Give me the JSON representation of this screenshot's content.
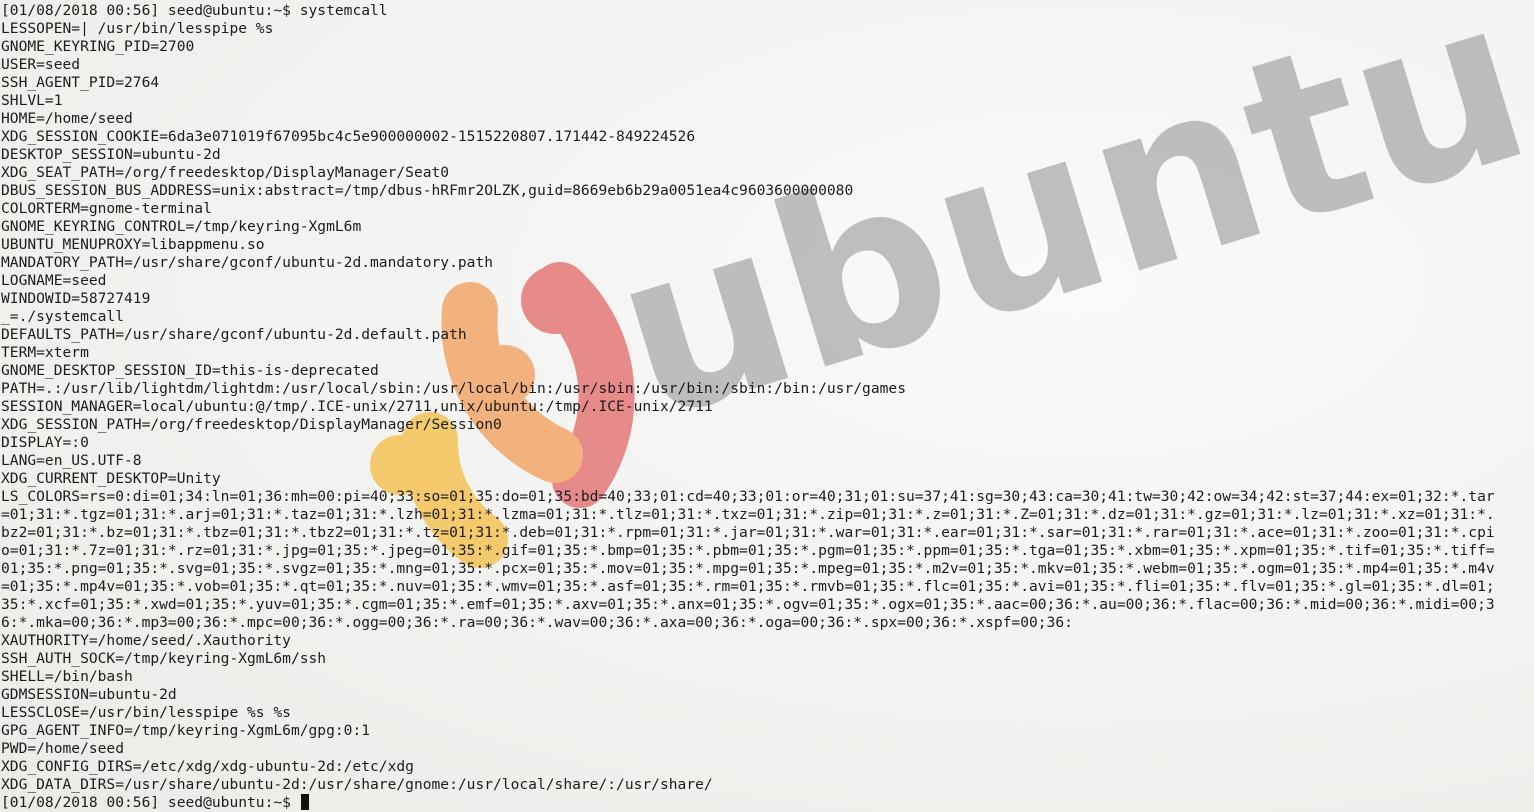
{
  "wallpaper": {
    "logo_text": "ubuntu",
    "logo_colors": {
      "red": "#dd4a4a",
      "orange": "#f08a38",
      "yellow": "#f5b21e"
    },
    "text_color": "#8f8f8f"
  },
  "terminal": {
    "lines": [
      "[01/08/2018 00:56] seed@ubuntu:~$ systemcall",
      "LESSOPEN=| /usr/bin/lesspipe %s",
      "GNOME_KEYRING_PID=2700",
      "USER=seed",
      "SSH_AGENT_PID=2764",
      "SHLVL=1",
      "HOME=/home/seed",
      "XDG_SESSION_COOKIE=6da3e071019f67095bc4c5e900000002-1515220807.171442-849224526",
      "DESKTOP_SESSION=ubuntu-2d",
      "XDG_SEAT_PATH=/org/freedesktop/DisplayManager/Seat0",
      "DBUS_SESSION_BUS_ADDRESS=unix:abstract=/tmp/dbus-hRFmr2OLZK,guid=8669eb6b29a0051ea4c9603600000080",
      "COLORTERM=gnome-terminal",
      "GNOME_KEYRING_CONTROL=/tmp/keyring-XgmL6m",
      "UBUNTU_MENUPROXY=libappmenu.so",
      "MANDATORY_PATH=/usr/share/gconf/ubuntu-2d.mandatory.path",
      "LOGNAME=seed",
      "WINDOWID=58727419",
      "_=./systemcall",
      "DEFAULTS_PATH=/usr/share/gconf/ubuntu-2d.default.path",
      "TERM=xterm",
      "GNOME_DESKTOP_SESSION_ID=this-is-deprecated",
      "PATH=.:/usr/lib/lightdm/lightdm:/usr/local/sbin:/usr/local/bin:/usr/sbin:/usr/bin:/sbin:/bin:/usr/games",
      "SESSION_MANAGER=local/ubuntu:@/tmp/.ICE-unix/2711,unix/ubuntu:/tmp/.ICE-unix/2711",
      "XDG_SESSION_PATH=/org/freedesktop/DisplayManager/Session0",
      "DISPLAY=:0",
      "LANG=en_US.UTF-8",
      "XDG_CURRENT_DESKTOP=Unity",
      "LS_COLORS=rs=0:di=01;34:ln=01;36:mh=00:pi=40;33:so=01;35:do=01;35:bd=40;33;01:cd=40;33;01:or=40;31;01:su=37;41:sg=30;43:ca=30;41:tw=30;42:ow=34;42:st=37;44:ex=01;32:*.tar",
      "=01;31:*.tgz=01;31:*.arj=01;31:*.taz=01;31:*.lzh=01;31:*.lzma=01;31:*.tlz=01;31:*.txz=01;31:*.zip=01;31:*.z=01;31:*.Z=01;31:*.dz=01;31:*.gz=01;31:*.lz=01;31:*.xz=01;31:*.",
      "bz2=01;31:*.bz=01;31:*.tbz=01;31:*.tbz2=01;31:*.tz=01;31:*.deb=01;31:*.rpm=01;31:*.jar=01;31:*.war=01;31:*.ear=01;31:*.sar=01;31:*.rar=01;31:*.ace=01;31:*.zoo=01;31:*.cpi",
      "o=01;31:*.7z=01;31:*.rz=01;31:*.jpg=01;35:*.jpeg=01;35:*.gif=01;35:*.bmp=01;35:*.pbm=01;35:*.pgm=01;35:*.ppm=01;35:*.tga=01;35:*.xbm=01;35:*.xpm=01;35:*.tif=01;35:*.tiff=",
      "01;35:*.png=01;35:*.svg=01;35:*.svgz=01;35:*.mng=01;35:*.pcx=01;35:*.mov=01;35:*.mpg=01;35:*.mpeg=01;35:*.m2v=01;35:*.mkv=01;35:*.webm=01;35:*.ogm=01;35:*.mp4=01;35:*.m4v",
      "=01;35:*.mp4v=01;35:*.vob=01;35:*.qt=01;35:*.nuv=01;35:*.wmv=01;35:*.asf=01;35:*.rm=01;35:*.rmvb=01;35:*.flc=01;35:*.avi=01;35:*.fli=01;35:*.flv=01;35:*.gl=01;35:*.dl=01;",
      "35:*.xcf=01;35:*.xwd=01;35:*.yuv=01;35:*.cgm=01;35:*.emf=01;35:*.axv=01;35:*.anx=01;35:*.ogv=01;35:*.ogx=01;35:*.aac=00;36:*.au=00;36:*.flac=00;36:*.mid=00;36:*.midi=00;3",
      "6:*.mka=00;36:*.mp3=00;36:*.mpc=00;36:*.ogg=00;36:*.ra=00;36:*.wav=00;36:*.axa=00;36:*.oga=00;36:*.spx=00;36:*.xspf=00;36:",
      "XAUTHORITY=/home/seed/.Xauthority",
      "SSH_AUTH_SOCK=/tmp/keyring-XgmL6m/ssh",
      "SHELL=/bin/bash",
      "GDMSESSION=ubuntu-2d",
      "LESSCLOSE=/usr/bin/lesspipe %s %s",
      "GPG_AGENT_INFO=/tmp/keyring-XgmL6m/gpg:0:1",
      "PWD=/home/seed",
      "XDG_CONFIG_DIRS=/etc/xdg/xdg-ubuntu-2d:/etc/xdg",
      "XDG_DATA_DIRS=/usr/share/ubuntu-2d:/usr/share/gnome:/usr/local/share/:/usr/share/"
    ],
    "prompt": "[01/08/2018 00:56] seed@ubuntu:~$ "
  }
}
